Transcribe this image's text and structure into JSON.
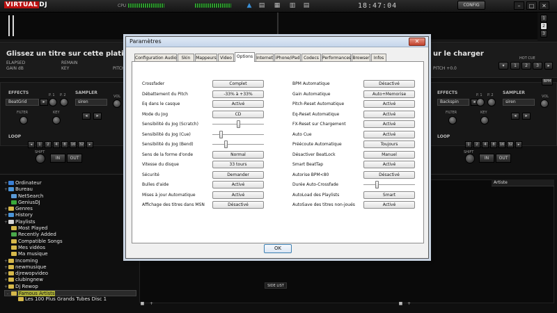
{
  "topbar": {
    "logo_part1": "VIRTUAL",
    "logo_part2": "DJ",
    "cpu_label": "CPU",
    "clock": "18:47:04",
    "config_label": "CONFIG",
    "deck_numbers": [
      "1",
      "2",
      "3"
    ]
  },
  "deck_left": {
    "title": "Glissez un titre sur cette platine pour le",
    "elapsed": "ELAPSED",
    "remain": "REMAIN",
    "gain": "GAIN dB",
    "key": "KEY",
    "pitch": "PITCH",
    "effects_label": "EFFECTS",
    "effect_value": "BeatGrid",
    "p1": "P. 1",
    "p2": "P. 2",
    "sampler_label": "SAMPLER",
    "sampler_value": "siren",
    "vol": "VOL",
    "filter": "FILTER",
    "key_label": "KEY",
    "loop_label": "LOOP",
    "loop_values": [
      "1",
      "2",
      "4",
      "8",
      "16",
      "32"
    ],
    "shift": "SHIFT",
    "in_label": "IN",
    "out_label": "OUT"
  },
  "deck_right": {
    "title": "ur le charger",
    "pitch_value": "PITCH +0.0",
    "hotcue": "HOT CUE",
    "hotcue_buttons": [
      "1",
      "2",
      "3"
    ],
    "effects_label": "EFFECTS",
    "effect_value": "Backspin",
    "p1": "P. 1",
    "p2": "P. 2",
    "sampler_label": "SAMPLER",
    "sampler_value": "siren",
    "vol": "VOL",
    "filter": "FILTER",
    "key_label": "KEY",
    "loop_label": "LOOP",
    "loop_values": [
      "1",
      "2",
      "4",
      "8",
      "16",
      "32"
    ],
    "shift": "SHIFT",
    "in_label": "IN",
    "out_label": "OUT",
    "bpm_badge": "BPM"
  },
  "browser": {
    "tree": [
      {
        "label": "Ordinateur",
        "tog": "+"
      },
      {
        "label": "Bureau",
        "tog": "+"
      },
      {
        "label": "NetSearch",
        "tog": ""
      },
      {
        "label": "GeniusDJ",
        "tog": ""
      },
      {
        "label": "Genres",
        "tog": "+"
      },
      {
        "label": "History",
        "tog": "+"
      },
      {
        "label": "Playlists",
        "tog": "+"
      },
      {
        "label": "Most Played",
        "tog": ""
      },
      {
        "label": "Recently Added",
        "tog": ""
      },
      {
        "label": "Compatible Songs",
        "tog": ""
      },
      {
        "label": "Mes vidéos",
        "tog": ""
      },
      {
        "label": "Ma musique",
        "tog": ""
      },
      {
        "label": "Incoming",
        "tog": "+"
      },
      {
        "label": "newmusique",
        "tog": "+"
      },
      {
        "label": "djrewopvideo",
        "tog": "+"
      },
      {
        "label": "clubingnew",
        "tog": "+"
      },
      {
        "label": "Dj Rewop",
        "tog": "+"
      },
      {
        "label": "Famous Artists",
        "tog": "-"
      },
      {
        "label": "Les 100 Plus Grands Tubes Disc 1",
        "tog": ""
      }
    ],
    "column_artiste": "Artiste",
    "side_list": "SIDE LIST"
  },
  "dialog": {
    "title": "Paramètres",
    "close": "✕",
    "tabs": [
      "Configuration Audio",
      "Skin",
      "Mappeurs",
      "Video",
      "Options",
      "Internet",
      "iPhone/iPad",
      "Codecs",
      "Performances",
      "Browser",
      "Infos"
    ],
    "active_tab": "Options",
    "left_rows": [
      {
        "label": "Crossfader",
        "value": "Complet"
      },
      {
        "label": "Débattement du Pitch",
        "value": "-33% à +33%"
      },
      {
        "label": "Eq dans le casque",
        "value": "Activé"
      },
      {
        "label": "Mode du Jog",
        "value": "CD"
      },
      {
        "label": "Sensibilité du Jog (Scratch)",
        "slider": 0.5
      },
      {
        "label": "Sensibilité du Jog (Cue)",
        "slider": 0.15
      },
      {
        "label": "Sensibilité du Jog (Bend)",
        "slider": 0.25
      },
      {
        "label": "Sens de la forme d'onde",
        "value": "Normal"
      },
      {
        "label": "Vitesse du disque",
        "value": "33 tours"
      },
      {
        "label": "Sécurité",
        "value": "Demander"
      },
      {
        "label": "Bulles d'aide",
        "value": "Activé"
      },
      {
        "label": "Mises à jour Automatique",
        "value": "Activé"
      },
      {
        "label": "Affichage des titres dans MSN",
        "value": "Désactivé"
      }
    ],
    "right_rows": [
      {
        "label": "BPM Automatique",
        "value": "Désactivé"
      },
      {
        "label": "Gain Automatique",
        "value": "Auto+Memorise"
      },
      {
        "label": "Pitch-Reset Automatique",
        "value": "Activé"
      },
      {
        "label": "Eq-Reset Automatique",
        "value": "Activé"
      },
      {
        "label": "FX-Reset sur Chargement",
        "value": "Activé"
      },
      {
        "label": "Auto Cue",
        "value": "Activé"
      },
      {
        "label": "Préécoute Automatique",
        "value": "Toujours"
      },
      {
        "label": "Désactiver BeatLock",
        "value": "Manuel"
      },
      {
        "label": "Smart BeatTap",
        "value": "Activé"
      },
      {
        "label": "Autorise BPM<80",
        "value": "Désactivé"
      },
      {
        "label": "Durée Auto-Crossfade",
        "slider": 0.25
      },
      {
        "label": "AutoLoad des Playlists",
        "value": "Smart"
      },
      {
        "label": "AutoSave des titres non-joués",
        "value": "Activé"
      }
    ],
    "ok_label": "OK"
  }
}
